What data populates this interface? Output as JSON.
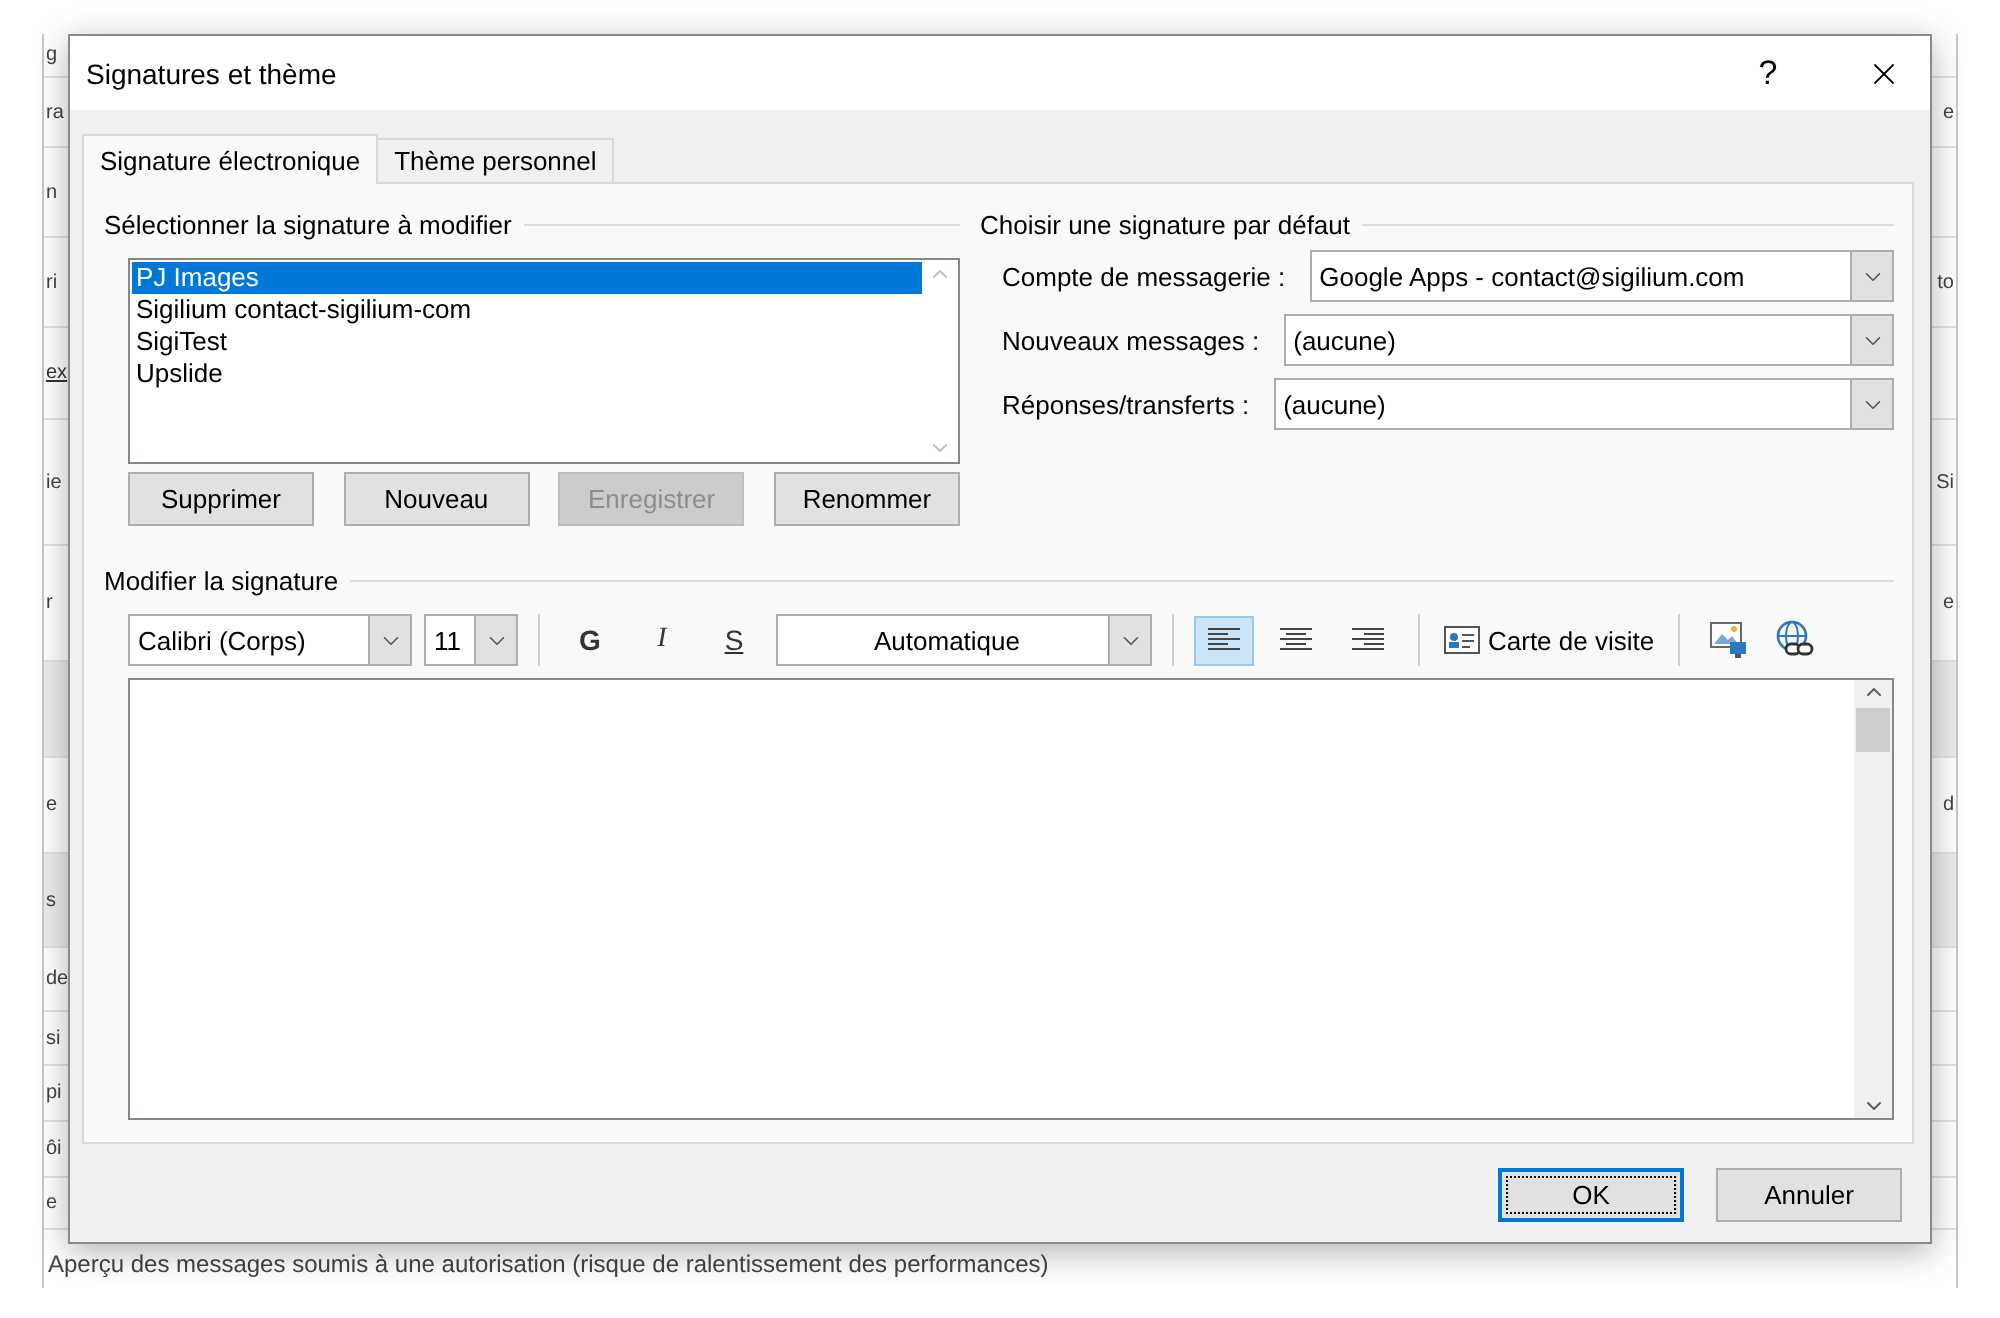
{
  "background": {
    "rows": [
      {
        "kind": "text",
        "left": "g"
      },
      {
        "kind": "text",
        "left": "ra",
        "right": "e"
      },
      {
        "kind": "text",
        "left": "n"
      },
      {
        "kind": "text",
        "left": "ri",
        "right": "to"
      },
      {
        "kind": "link",
        "left": "ex"
      },
      {
        "kind": "text",
        "left": "ie",
        "right": "Si"
      },
      {
        "kind": "text",
        "left": "r",
        "right": "e"
      },
      {
        "kind": "band"
      },
      {
        "kind": "text",
        "left": "e",
        "right": "d"
      },
      {
        "kind": "band",
        "left": "s"
      },
      {
        "kind": "text",
        "left": "de"
      },
      {
        "kind": "text",
        "left": "si"
      },
      {
        "kind": "text",
        "left": "pi"
      },
      {
        "kind": "text",
        "left": "ôi"
      },
      {
        "kind": "text",
        "left": "e"
      }
    ],
    "footer_text": "Aperçu des messages soumis à une autorisation (risque de ralentissement des performances)"
  },
  "dialog": {
    "title": "Signatures et thème",
    "help": "?",
    "tabs": [
      {
        "label": "Signature électronique",
        "selected": true
      },
      {
        "label": "Thème personnel",
        "selected": false
      }
    ],
    "select_group": {
      "title": "Sélectionner la signature à modifier",
      "signatures": [
        {
          "name": "PJ Images",
          "selected": true
        },
        {
          "name": "Sigilium contact-sigilium-com",
          "selected": false
        },
        {
          "name": "SigiTest",
          "selected": false
        },
        {
          "name": "Upslide",
          "selected": false
        }
      ],
      "buttons": [
        {
          "label": "Supprimer",
          "disabled": false
        },
        {
          "label": "Nouveau",
          "disabled": false
        },
        {
          "label": "Enregistrer",
          "disabled": true
        },
        {
          "label": "Renommer",
          "disabled": false
        }
      ]
    },
    "default_group": {
      "title": "Choisir une signature par défaut",
      "fields": [
        {
          "label": "Compte de messagerie :",
          "value": "Google Apps - contact@sigilium.com"
        },
        {
          "label": "Nouveaux messages :",
          "value": "(aucune)"
        },
        {
          "label": "Réponses/transferts :",
          "value": "(aucune)"
        }
      ]
    },
    "edit_group": {
      "title": "Modifier la signature",
      "font": "Calibri (Corps)",
      "size": "11",
      "styles": [
        {
          "kind": "bold",
          "label": "G"
        },
        {
          "kind": "italic",
          "label": "I"
        },
        {
          "kind": "underline",
          "label": "S"
        }
      ],
      "font_color": "Automatique",
      "alignments": [
        {
          "kind": "left",
          "selected": true
        },
        {
          "kind": "center",
          "selected": false
        },
        {
          "kind": "right",
          "selected": false
        }
      ],
      "business_card": "Carte de visite"
    },
    "footer": {
      "buttons": [
        {
          "label": "OK",
          "default": true
        },
        {
          "label": "Annuler",
          "default": false
        }
      ]
    }
  }
}
